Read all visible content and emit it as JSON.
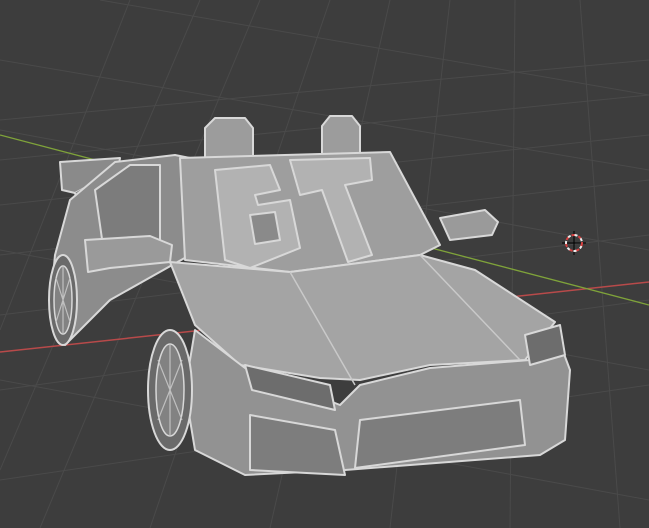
{
  "viewport": {
    "background": "#3d3d3d",
    "grid_color": "#4a4a4a",
    "axis_x_color": "#b84a4a",
    "axis_y_color": "#7fa33a"
  },
  "object": {
    "material_color": "#9a9a9a",
    "edge_color": "#d8d8d8",
    "shadow_color": "#5e5e5e",
    "icon": "3d-car-mesh-icon",
    "decal_text": "67"
  },
  "cursor": {
    "icon": "3d-cursor-icon",
    "ring_color": "#d94040"
  }
}
